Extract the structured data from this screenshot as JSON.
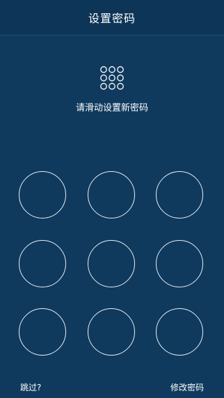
{
  "header": {
    "title": "设置密码"
  },
  "pattern_icon": "pattern-dots-icon",
  "hint": "请滑动设置新密码",
  "pattern_grid": {
    "rows": 3,
    "cols": 3
  },
  "footer": {
    "skip_label": "跳过?",
    "change_password_label": "修改密码"
  },
  "colors": {
    "background": "#0f3a5e",
    "header_background": "#0d3557",
    "node_border": "#e8eef5",
    "text": "#ffffff"
  }
}
